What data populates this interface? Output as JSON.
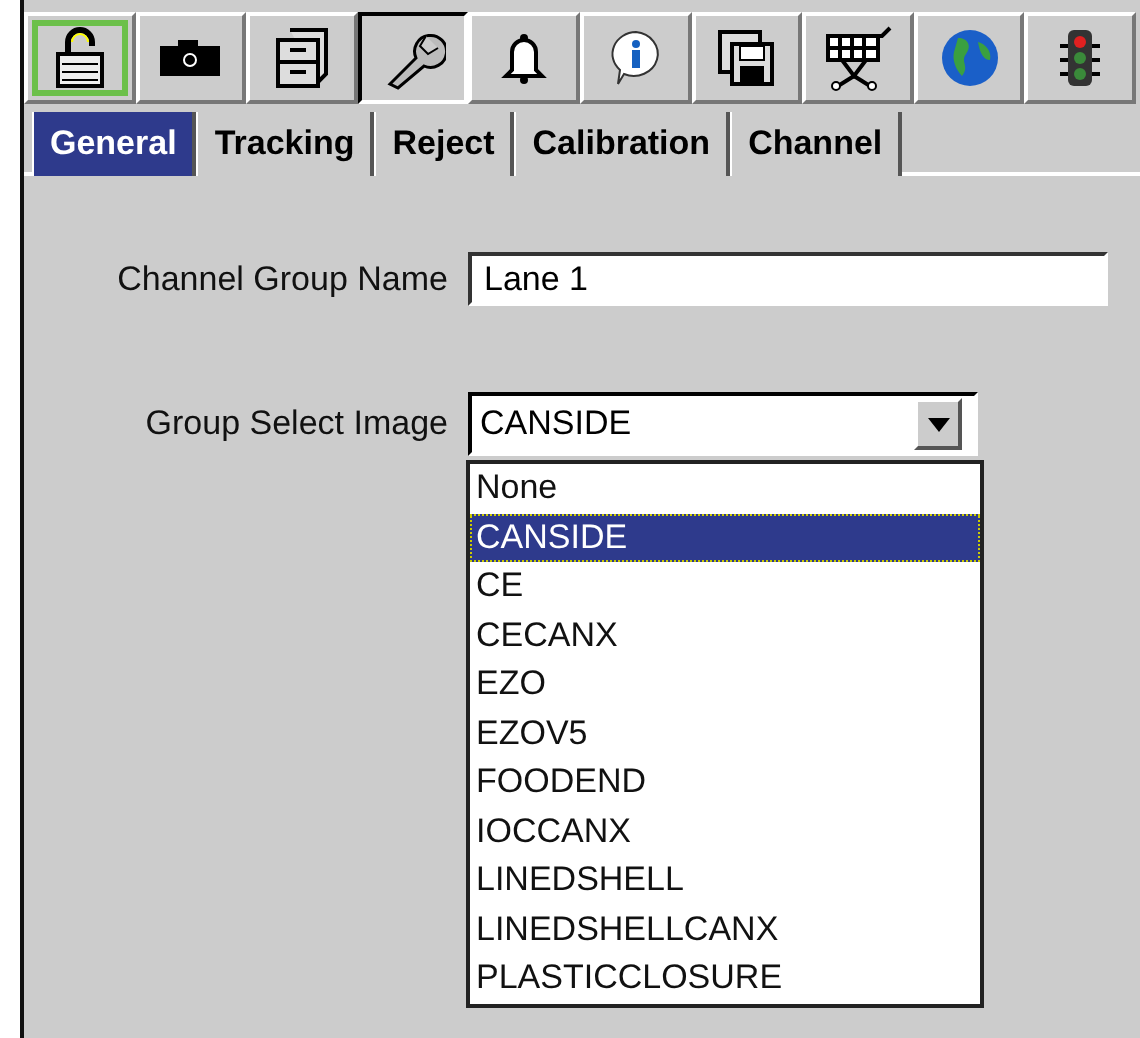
{
  "toolbar": [
    {
      "kind": "lock",
      "selected": true,
      "pressed": false
    },
    {
      "kind": "camera",
      "selected": false,
      "pressed": false
    },
    {
      "kind": "cabinet",
      "selected": false,
      "pressed": false
    },
    {
      "kind": "wrench",
      "selected": false,
      "pressed": true
    },
    {
      "kind": "bell",
      "selected": false,
      "pressed": false
    },
    {
      "kind": "info",
      "selected": false,
      "pressed": false
    },
    {
      "kind": "floppy",
      "selected": false,
      "pressed": false
    },
    {
      "kind": "cart",
      "selected": false,
      "pressed": false
    },
    {
      "kind": "globe",
      "selected": false,
      "pressed": false
    },
    {
      "kind": "traffic-light",
      "selected": false,
      "pressed": false
    }
  ],
  "tabs": [
    {
      "label": "General",
      "selected": true
    },
    {
      "label": "Tracking",
      "selected": false
    },
    {
      "label": "Reject",
      "selected": false
    },
    {
      "label": "Calibration",
      "selected": false
    },
    {
      "label": "Channel",
      "selected": false
    }
  ],
  "form": {
    "name_field": {
      "label": "Channel Group Name",
      "value": "Lane 1"
    },
    "image_select": {
      "label": "Group Select Image",
      "value": "CANSIDE",
      "expanded": true,
      "options": [
        {
          "label": "None",
          "selected": false
        },
        {
          "label": "CANSIDE",
          "selected": true
        },
        {
          "label": "CE",
          "selected": false
        },
        {
          "label": "CECANX",
          "selected": false
        },
        {
          "label": "EZO",
          "selected": false
        },
        {
          "label": "EZOV5",
          "selected": false
        },
        {
          "label": "FOODEND",
          "selected": false
        },
        {
          "label": "IOCCANX",
          "selected": false
        },
        {
          "label": "LINEDSHELL",
          "selected": false
        },
        {
          "label": "LINEDSHELLCANX",
          "selected": false
        },
        {
          "label": "PLASTICCLOSURE",
          "selected": false
        }
      ]
    }
  }
}
